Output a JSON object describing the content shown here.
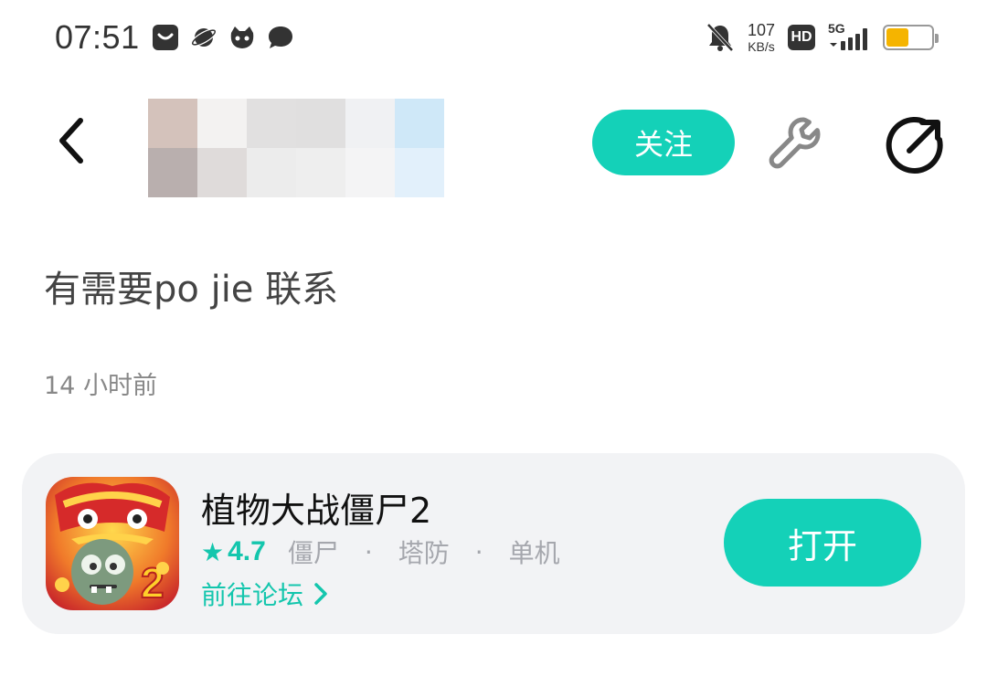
{
  "status_bar": {
    "time": "07:51",
    "app_icons": [
      "notification-app-icon",
      "planet-app-icon",
      "cat-app-icon",
      "chat-bubble-icon"
    ],
    "net_speed_value": "107",
    "net_speed_unit": "KB/s",
    "hd_label": "HD",
    "network_label": "5G",
    "battery_level": 0.5,
    "battery_color": "#f5b400"
  },
  "header": {
    "back_icon": "chevron-left-icon",
    "avatar_pixels": [
      "#d4c2bb",
      "#f3f2f1",
      "#e1e0e0",
      "#e0dfdf",
      "#f0f1f3",
      "#cfe8f8",
      "#b9afae",
      "#dfdbda",
      "#ececec",
      "#eeeeee",
      "#f4f4f5",
      "#e2f0fb"
    ],
    "follow_label": "关注",
    "wrench_icon": "wrench-icon",
    "share_icon": "share-icon"
  },
  "post": {
    "text": "有需要po jie 联系",
    "time": "14 小时前"
  },
  "game_card": {
    "name": "植物大战僵尸2",
    "rating": "4.7",
    "tags": [
      "僵尸",
      "塔防",
      "单机"
    ],
    "forum_label": "前往论坛",
    "open_label": "打开"
  },
  "colors": {
    "accent": "#14d1b8",
    "accent_text": "#14c6ad",
    "muted": "#a5a7ad",
    "card_bg": "#f2f3f5"
  }
}
